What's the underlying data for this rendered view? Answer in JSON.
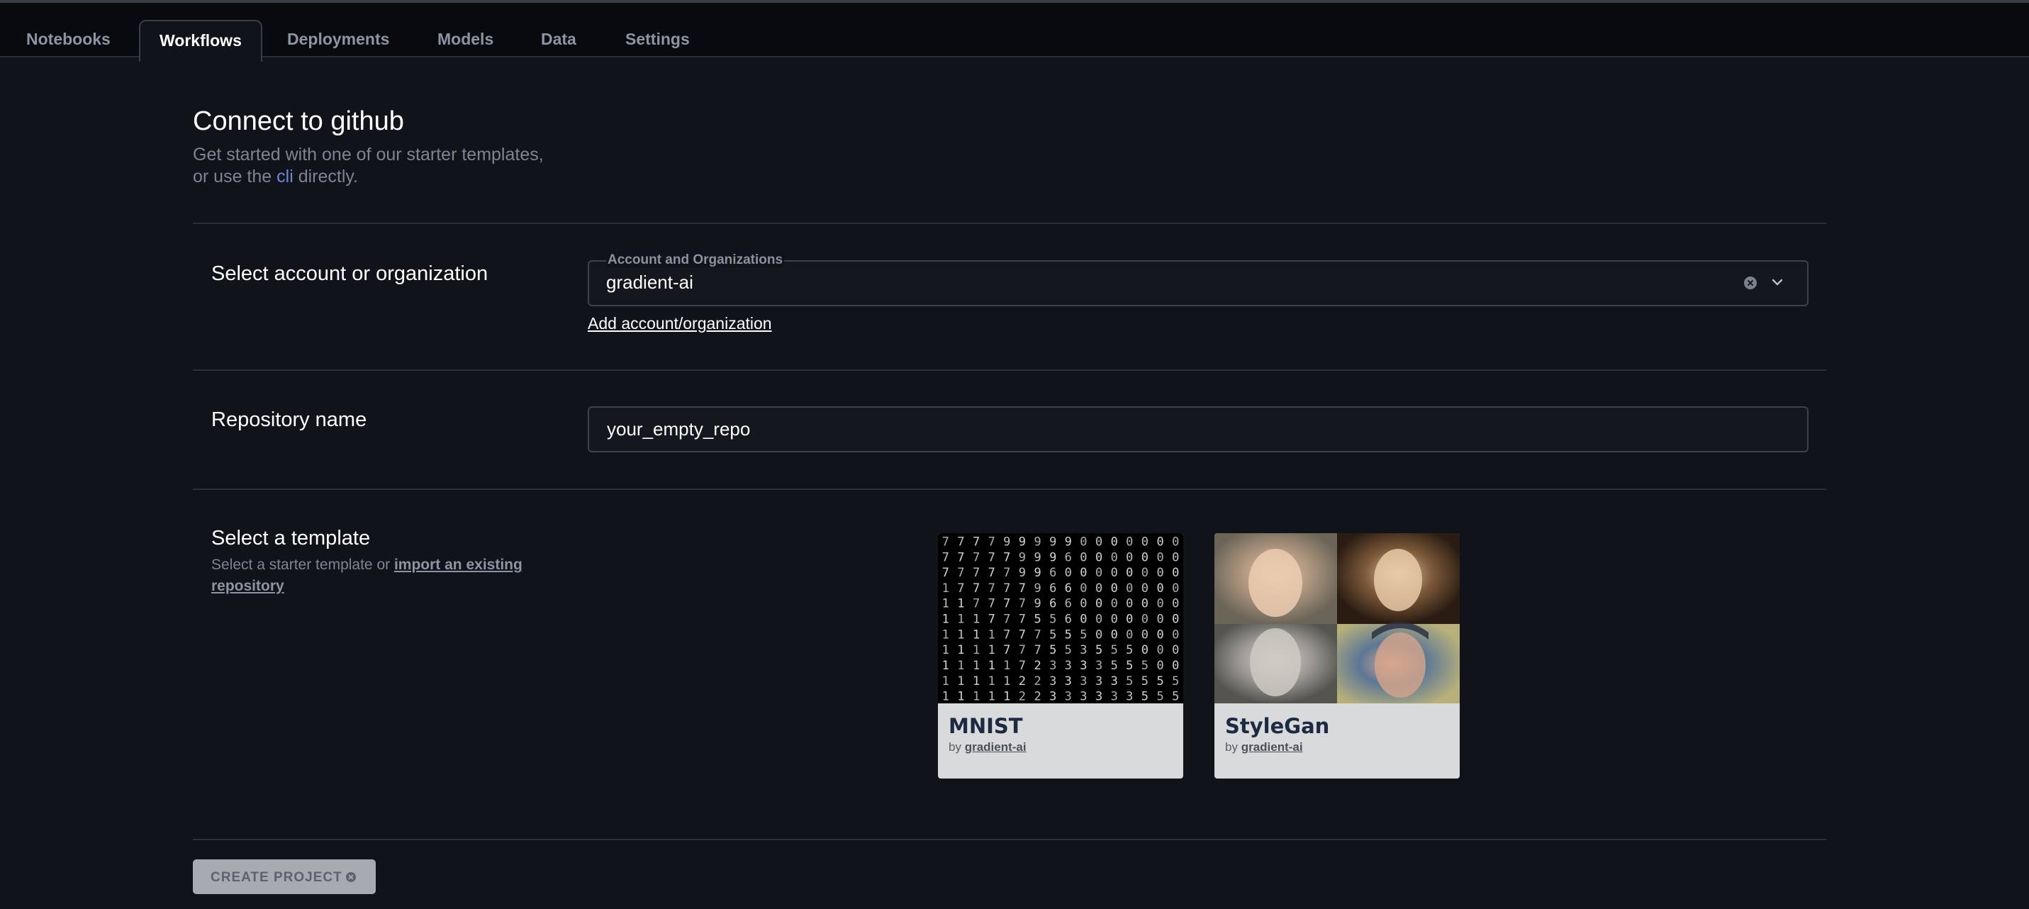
{
  "tabs": [
    {
      "label": "Notebooks",
      "active": false
    },
    {
      "label": "Workflows",
      "active": true
    },
    {
      "label": "Deployments",
      "active": false
    },
    {
      "label": "Models",
      "active": false
    },
    {
      "label": "Data",
      "active": false
    },
    {
      "label": "Settings",
      "active": false
    }
  ],
  "header": {
    "title": "Connect to github",
    "subtitle_line1": "Get started with one of our starter templates,",
    "subtitle_line2_prefix": "or use the ",
    "subtitle_link": "cli",
    "subtitle_line2_suffix": " directly."
  },
  "account": {
    "label": "Select account or organization",
    "field_legend": "Account and Organizations",
    "value": "gradient-ai",
    "add_link": "Add account/organization"
  },
  "repository": {
    "label": "Repository name",
    "value": "your_empty_repo"
  },
  "template": {
    "label": "Select a template",
    "sub_prefix": "Select a starter template or ",
    "sub_link": "import an existing repository",
    "cards": [
      {
        "title": "MNIST",
        "by": "by ",
        "author": "gradient-ai",
        "icon": "mnist-digit-grid-image"
      },
      {
        "title": "StyleGan",
        "by": "by ",
        "author": "gradient-ai",
        "icon": "stylegan-portraits-image"
      }
    ]
  },
  "actions": {
    "create_label": "CREATE PROJECT"
  },
  "colors": {
    "background": "#101319",
    "topbar": "#080a0d",
    "link": "#6f86d6",
    "card": "#d9dadc",
    "button": "#a7aab0"
  }
}
